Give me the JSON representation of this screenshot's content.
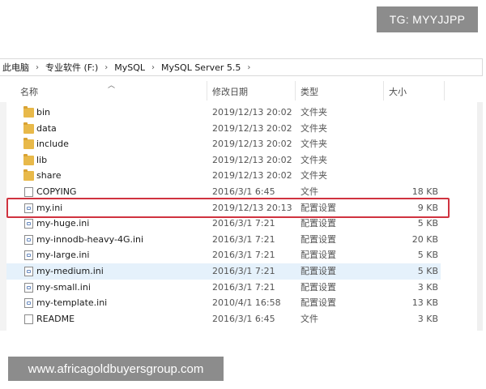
{
  "watermarks": {
    "top": "TG: MYYJJPP",
    "bottom": "www.africagoldbuyersgroup.com"
  },
  "breadcrumb": [
    "此电脑",
    "专业软件 (F:)",
    "MySQL",
    "MySQL Server 5.5"
  ],
  "breadcrumb_separator": "›",
  "columns": {
    "name": "名称",
    "date": "修改日期",
    "type": "类型",
    "size": "大小"
  },
  "files": [
    {
      "name": "bin",
      "date": "2019/12/13 20:02",
      "type": "文件夹",
      "size": "",
      "icon": "folder-icon"
    },
    {
      "name": "data",
      "date": "2019/12/13 20:02",
      "type": "文件夹",
      "size": "",
      "icon": "folder-icon"
    },
    {
      "name": "include",
      "date": "2019/12/13 20:02",
      "type": "文件夹",
      "size": "",
      "icon": "folder-icon"
    },
    {
      "name": "lib",
      "date": "2019/12/13 20:02",
      "type": "文件夹",
      "size": "",
      "icon": "folder-icon"
    },
    {
      "name": "share",
      "date": "2019/12/13 20:02",
      "type": "文件夹",
      "size": "",
      "icon": "folder-icon"
    },
    {
      "name": "COPYING",
      "date": "2016/3/1 6:45",
      "type": "文件",
      "size": "18 KB",
      "icon": "file-icon"
    },
    {
      "name": "my.ini",
      "date": "2019/12/13 20:13",
      "type": "配置设置",
      "size": "9 KB",
      "icon": "ini-file-icon"
    },
    {
      "name": "my-huge.ini",
      "date": "2016/3/1 7:21",
      "type": "配置设置",
      "size": "5 KB",
      "icon": "ini-file-icon"
    },
    {
      "name": "my-innodb-heavy-4G.ini",
      "date": "2016/3/1 7:21",
      "type": "配置设置",
      "size": "20 KB",
      "icon": "ini-file-icon"
    },
    {
      "name": "my-large.ini",
      "date": "2016/3/1 7:21",
      "type": "配置设置",
      "size": "5 KB",
      "icon": "ini-file-icon"
    },
    {
      "name": "my-medium.ini",
      "date": "2016/3/1 7:21",
      "type": "配置设置",
      "size": "5 KB",
      "icon": "ini-file-icon"
    },
    {
      "name": "my-small.ini",
      "date": "2016/3/1 7:21",
      "type": "配置设置",
      "size": "3 KB",
      "icon": "ini-file-icon"
    },
    {
      "name": "my-template.ini",
      "date": "2010/4/1 16:58",
      "type": "配置设置",
      "size": "13 KB",
      "icon": "ini-file-icon"
    },
    {
      "name": "README",
      "date": "2016/3/1 6:45",
      "type": "文件",
      "size": "3 KB",
      "icon": "file-icon"
    }
  ],
  "selected_row": "my-medium.ini",
  "highlighted_row": "my.ini",
  "colors": {
    "highlight_border": "#d0333f",
    "selection": "#e5f1fb",
    "folder": "#e8b94a"
  }
}
